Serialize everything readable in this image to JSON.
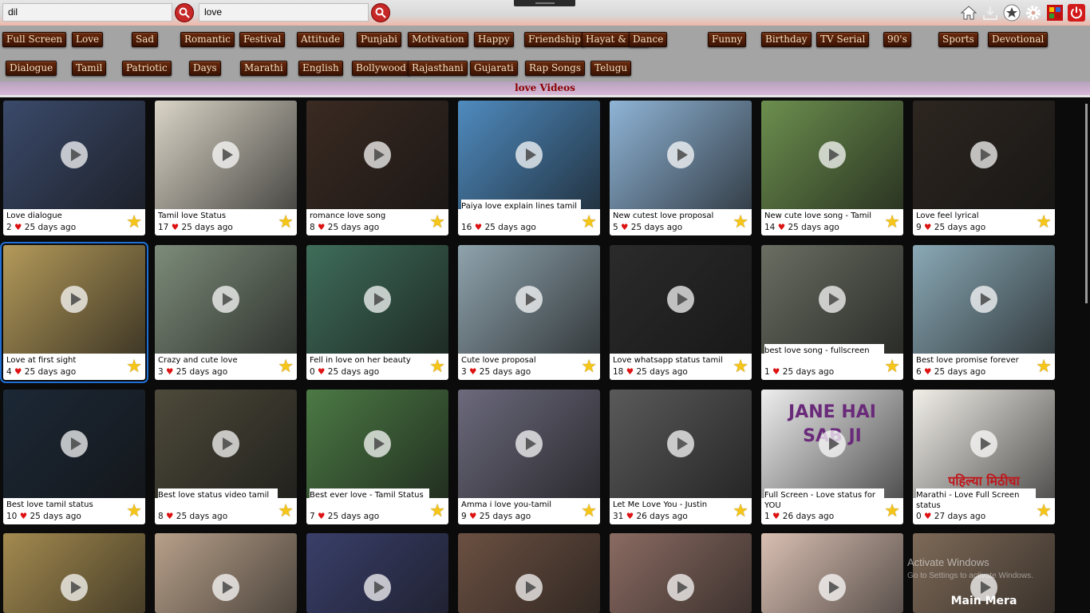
{
  "search": {
    "primary_value": "dil",
    "secondary_value": "love"
  },
  "toolbar": {
    "icons": [
      "home-icon",
      "download-icon",
      "favorites-star-icon",
      "settings-gear-icon",
      "app-tiles-icon",
      "power-icon"
    ]
  },
  "categories_row1": [
    "Full Screen",
    "Love",
    "Sad",
    "Romantic",
    "Festival",
    "Attitude",
    "Punjabi",
    "Motivation",
    "Happy",
    "Friendship",
    "Hayat & Mu",
    "Dance",
    "Funny",
    "Birthday",
    "TV Serial",
    "90's",
    "Sports",
    "Devotional"
  ],
  "categories_row2": [
    "Dialogue",
    "Tamil",
    "Patriotic",
    "Days",
    "Marathi",
    "English",
    "Bollywood",
    "Rajasthani",
    "Gujarati",
    "Rap Songs",
    "Telugu"
  ],
  "section_title": "love Videos",
  "videos": [
    {
      "title": "Love dialogue",
      "likes": "2",
      "age": "25 days ago",
      "color": "#3b4a6b"
    },
    {
      "title": "Tamil love Status",
      "likes": "17",
      "age": "25 days ago",
      "color": "#d9d4c6"
    },
    {
      "title": "romance love song",
      "likes": "8",
      "age": "25 days ago",
      "color": "#3a2a22"
    },
    {
      "title": "Paiya love explain lines tamil",
      "likes": "16",
      "age": "25 days ago",
      "color": "#4f8bbf"
    },
    {
      "title": "New cutest love proposal",
      "likes": "5",
      "age": "25 days ago",
      "color": "#8fb4d6"
    },
    {
      "title": "New cute love song - Tamil",
      "likes": "14",
      "age": "25 days ago",
      "color": "#6c8f4e"
    },
    {
      "title": "Love feel lyrical",
      "likes": "9",
      "age": "25 days ago",
      "color": "#2d2620"
    },
    {
      "title": "Love at first sight",
      "likes": "4",
      "age": "25 days ago",
      "color": "#b49a5a"
    },
    {
      "title": "Crazy and cute love",
      "likes": "3",
      "age": "25 days ago",
      "color": "#7d8c7a"
    },
    {
      "title": "Fell in love on her beauty",
      "likes": "0",
      "age": "25 days ago",
      "color": "#3f6d5a"
    },
    {
      "title": "Cute love proposal",
      "likes": "3",
      "age": "25 days ago",
      "color": "#8fa3ad"
    },
    {
      "title": "Love whatsapp status tamil",
      "likes": "18",
      "age": "25 days ago",
      "color": "#2b2b2b"
    },
    {
      "title": "best love song - fullscreen",
      "likes": "1",
      "age": "25 days ago",
      "color": "#6a6e62"
    },
    {
      "title": "Best love promise forever",
      "likes": "6",
      "age": "25 days ago",
      "color": "#8aa9b6"
    },
    {
      "title": "Best love tamil status",
      "likes": "10",
      "age": "25 days ago",
      "color": "#1c2836"
    },
    {
      "title": "Best love status video tamil",
      "likes": "8",
      "age": "25 days ago",
      "color": "#4d4a3a"
    },
    {
      "title": "Best ever love - Tamil Status",
      "likes": "7",
      "age": "25 days ago",
      "color": "#4c7a45"
    },
    {
      "title": "Amma i love you-tamil",
      "likes": "9",
      "age": "25 days ago",
      "color": "#6c6a7c"
    },
    {
      "title": "Let Me Love You - Justin",
      "likes": "31",
      "age": "26 days ago",
      "color": "#5a5a5a"
    },
    {
      "title": "Full Screen - Love status for YOU",
      "likes": "1",
      "age": "26 days ago",
      "color": "#eeeeee",
      "thumb_text": "JANE HAI SAB JI"
    },
    {
      "title": "Marathi - Love Full Screen status",
      "likes": "0",
      "age": "27 days ago",
      "color": "#f2efe9",
      "thumb_text": "पहिल्या मिठीचा"
    },
    {
      "title": "",
      "likes": "",
      "age": "",
      "color": "#a38a4f"
    },
    {
      "title": "",
      "likes": "",
      "age": "",
      "color": "#b7a08a"
    },
    {
      "title": "",
      "likes": "",
      "age": "",
      "color": "#3a3f6a"
    },
    {
      "title": "",
      "likes": "",
      "age": "",
      "color": "#6b5042"
    },
    {
      "title": "",
      "likes": "",
      "age": "",
      "color": "#8a6b62"
    },
    {
      "title": "",
      "likes": "",
      "age": "",
      "color": "#d9bfb2"
    },
    {
      "title": "",
      "likes": "",
      "age": "",
      "color": "#7e6a58",
      "thumb_text": "Main Mera"
    }
  ],
  "watermark": {
    "line1": "Activate Windows",
    "line2": "Go to Settings to activate Windows."
  },
  "colors": {
    "accent": "#c62828",
    "chip": "#5a220a",
    "band_text": "#8b0000",
    "star": "#f5c518",
    "heart": "#d11111"
  }
}
